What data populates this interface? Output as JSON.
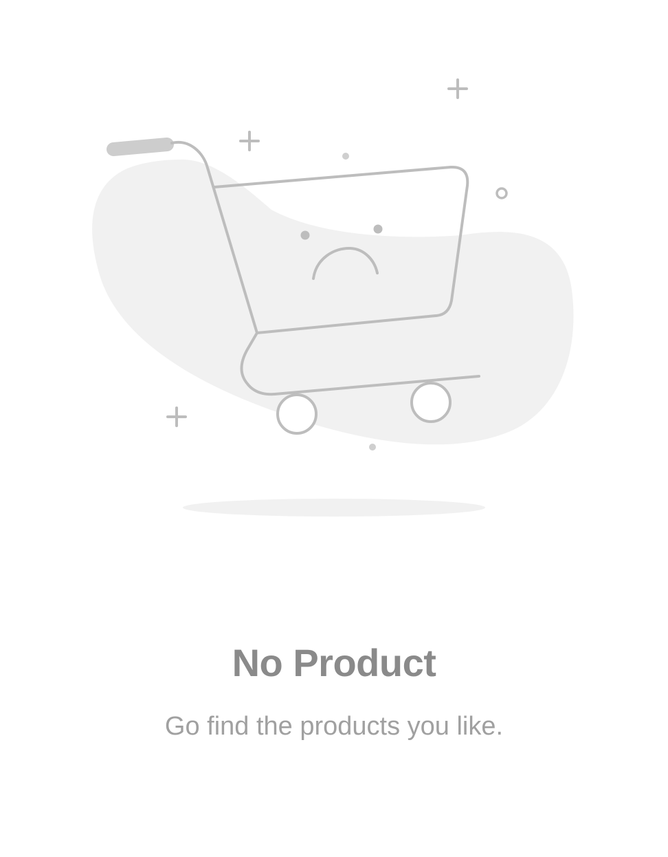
{
  "empty_state": {
    "title": "No Product",
    "subtitle": "Go find the products you like.",
    "illustration": "sad-shopping-cart-icon"
  },
  "colors": {
    "background": "#ffffff",
    "blob": "#f1f1f1",
    "line_art": "#bdbdbd",
    "title": "#8a8a8a",
    "subtitle": "#a0a0a0"
  }
}
